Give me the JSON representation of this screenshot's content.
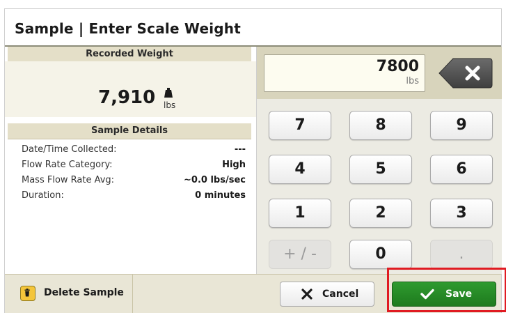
{
  "dialog": {
    "title": "Sample | Enter Scale Weight"
  },
  "recorded": {
    "header": "Recorded Weight",
    "value": "7,910",
    "unit": "lbs",
    "icon": "weight-icon"
  },
  "details": {
    "header": "Sample Details",
    "rows": [
      {
        "label": "Date/Time Collected:",
        "value": "---"
      },
      {
        "label": "Flow Rate Category:",
        "value": "High"
      },
      {
        "label": "Mass Flow Rate Avg:",
        "value": "~0.0 lbs/sec"
      },
      {
        "label": "Duration:",
        "value": "0 minutes"
      }
    ]
  },
  "entry": {
    "value": "7800",
    "unit": "lbs",
    "backspace_icon": "backspace-icon"
  },
  "keypad": [
    "7",
    "8",
    "9",
    "4",
    "5",
    "6",
    "1",
    "2",
    "3",
    "+ / -",
    "0",
    "."
  ],
  "actions": {
    "delete_label": "Delete Sample",
    "cancel_label": "Cancel",
    "save_label": "Save"
  },
  "colors": {
    "accent": "#1e7b1e",
    "highlight": "#e01b22",
    "band": "#d8d4bc"
  }
}
